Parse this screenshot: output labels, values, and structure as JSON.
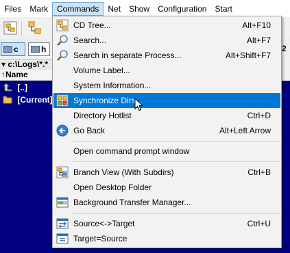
{
  "menubar": {
    "items": [
      {
        "label": "Files",
        "active": false
      },
      {
        "label": "Mark",
        "active": false
      },
      {
        "label": "Commands",
        "active": true
      },
      {
        "label": "Net",
        "active": false
      },
      {
        "label": "Show",
        "active": false
      },
      {
        "label": "Configuration",
        "active": false
      },
      {
        "label": "Start",
        "active": false
      }
    ]
  },
  "drives": {
    "left": "c",
    "right": "h",
    "partial_text": "2"
  },
  "panel": {
    "path": "▾ c:\\Logs\\*.*",
    "column_name": "↑Name",
    "rows": [
      "[..]",
      "[Current]"
    ]
  },
  "commands_menu": {
    "items": [
      {
        "label": "CD Tree...",
        "shortcut": "Alt+F10",
        "icon": "tree-icon"
      },
      {
        "label": "Search...",
        "shortcut": "Alt+F7",
        "icon": "magnifier-icon"
      },
      {
        "label": "Search in separate Process...",
        "shortcut": "Alt+Shift+F7",
        "icon": "magnifier-icon"
      },
      {
        "label": "Volume Label...",
        "shortcut": "",
        "icon": ""
      },
      {
        "label": "System Information...",
        "shortcut": "",
        "icon": ""
      },
      {
        "label": "Synchronize Dirs...",
        "shortcut": "",
        "icon": "sync-dirs-icon",
        "highlighted": true
      },
      {
        "label": "Directory Hotlist",
        "shortcut": "Ctrl+D",
        "icon": ""
      },
      {
        "label": "Go Back",
        "shortcut": "Alt+Left Arrow",
        "icon": "back-arrow-icon"
      },
      {
        "label": "Open command prompt window",
        "shortcut": "",
        "icon": ""
      },
      {
        "label": "Branch View (With Subdirs)",
        "shortcut": "Ctrl+B",
        "icon": "branch-view-icon"
      },
      {
        "label": "Open Desktop Folder",
        "shortcut": "",
        "icon": ""
      },
      {
        "label": "Background Transfer Manager...",
        "shortcut": "",
        "icon": "transfer-manager-icon"
      },
      {
        "label": "Source<->Target",
        "shortcut": "Ctrl+U",
        "icon": "swap-panels-icon"
      },
      {
        "label": "Target=Source",
        "shortcut": "",
        "icon": "target-equals-source-icon"
      }
    ]
  },
  "colors": {
    "panel_bg": "#000080",
    "highlight": "#0078d7",
    "menu_bg": "#f2f2f2"
  }
}
